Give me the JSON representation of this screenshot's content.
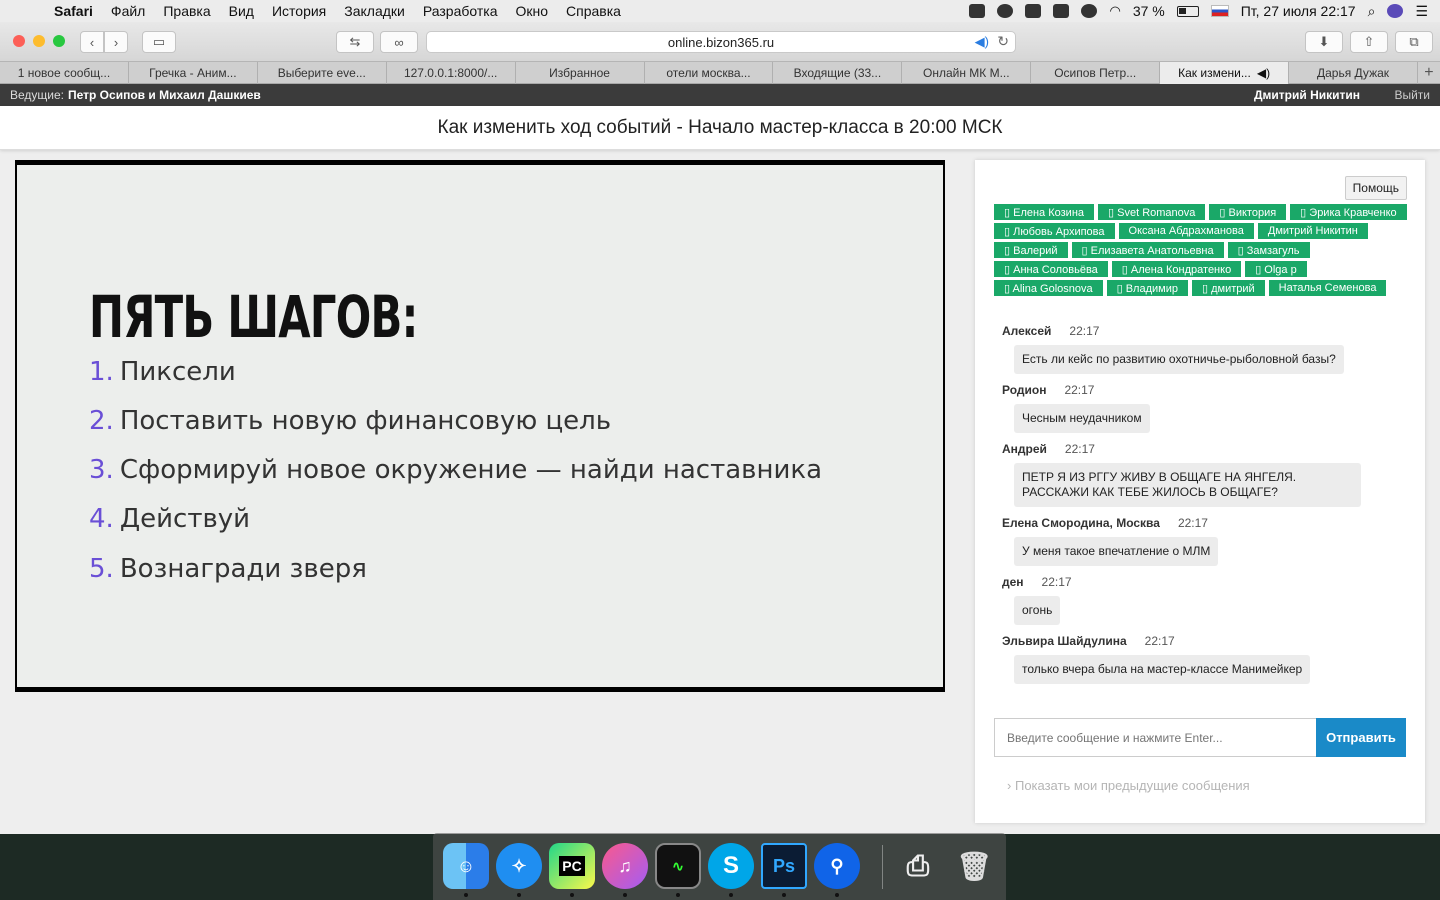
{
  "menubar": {
    "app": "Safari",
    "items": [
      "Файл",
      "Правка",
      "Вид",
      "История",
      "Закладки",
      "Разработка",
      "Окно",
      "Справка"
    ],
    "battery": "37 %",
    "datetime": "Пт, 27 июля  22:17"
  },
  "browser": {
    "url": "online.bizon365.ru",
    "tabs": [
      "1 новое сообщ...",
      "Гречка - Аним...",
      "Выберите eve...",
      "127.0.0.1:8000/...",
      "Избранное",
      "отели москва...",
      "Входящие (33...",
      "Онлайн МК М...",
      "Осипов Петр...",
      "Как измени...",
      "Дарья Дужак"
    ]
  },
  "hostbar": {
    "label": "Ведущие:",
    "hosts": "Петр Осипов и Михаил Дашкиев",
    "user": "Дмитрий Никитин",
    "logout": "Выйти"
  },
  "page": {
    "title": "Как изменить ход событий - Начало мастер-класса в 20:00 МСК"
  },
  "slide": {
    "title": "ПЯТЬ ШАГОВ:",
    "steps": [
      {
        "n": "1.",
        "text": "Пиксели"
      },
      {
        "n": "2.",
        "text": "Поставить новую финансовую цель"
      },
      {
        "n": "3.",
        "text": "Сформируй новое окружение — найди наставника"
      },
      {
        "n": "4.",
        "text": "Действуй"
      },
      {
        "n": "5.",
        "text": "Вознагради зверя"
      }
    ]
  },
  "chat": {
    "help": "Помощь",
    "users": [
      "▯ Елена Козина",
      "▯ Svet Romanova",
      "▯ Виктория",
      "▯ Эрика Кравченко",
      "▯ Любовь Архипова",
      "Оксана Абдрахманова",
      "Дмитрий Никитин",
      "▯ Валерий",
      "▯ Елизавета Анатольевна",
      "▯ Замзагуль",
      "▯ Анна Соловьёва",
      "▯ Алена Кондратенко",
      "▯ Olga p",
      "▯ Alina Golosnova",
      "▯ Владимир",
      "▯ дмитрий",
      "Наталья Семенова"
    ],
    "messages": [
      {
        "author": "Алексей",
        "time": "22:17",
        "text": "Есть ли кейс по развитию охотничье-рыболовной базы?"
      },
      {
        "author": "Родион",
        "time": "22:17",
        "text": "Чесным неудачником"
      },
      {
        "author": "Андрей",
        "time": "22:17",
        "text": "ПЕТР Я ИЗ РГГУ ЖИВУ В ОБЩАГЕ НА ЯНГЕЛЯ. РАССКАЖИ КАК ТЕБЕ ЖИЛОСЬ В ОБЩАГЕ?"
      },
      {
        "author": "Елена Смородина, Москва",
        "time": "22:17",
        "text": "У меня такое впечатление о МЛМ"
      },
      {
        "author": "ден",
        "time": "22:17",
        "text": "огонь"
      },
      {
        "author": "Эльвира Шайдулина",
        "time": "22:17",
        "text": "только вчера была на мастер-классе Манимейкер"
      }
    ],
    "input_placeholder": "Введите сообщение и нажмите Enter...",
    "send": "Отправить",
    "show_previous": "Показать мои предыдущие сообщения"
  },
  "dock": {
    "apps": [
      "finder-icon",
      "safari-icon",
      "pycharm-icon",
      "itunes-icon",
      "activity-monitor-icon",
      "skype-icon",
      "photoshop-icon",
      "maps-pin-icon",
      "printer-icon",
      "trash-icon"
    ]
  }
}
